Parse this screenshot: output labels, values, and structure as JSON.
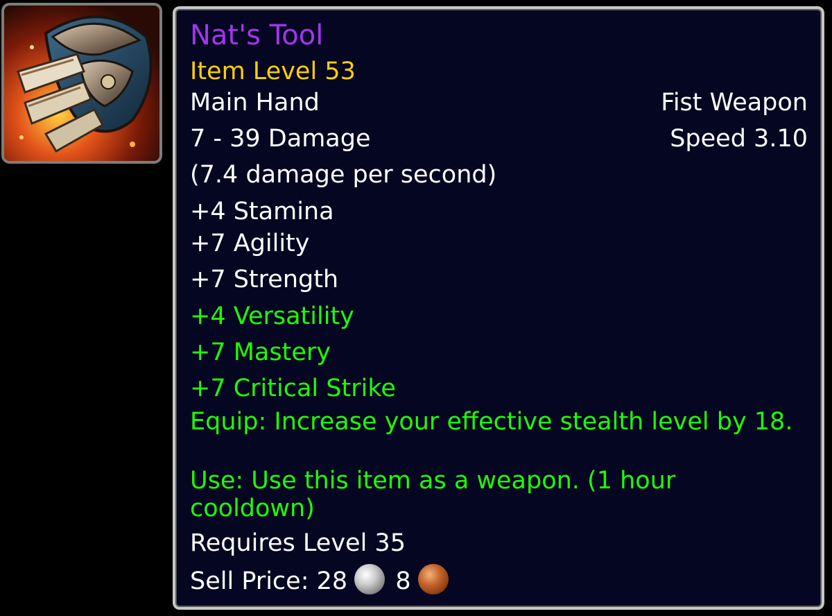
{
  "item": {
    "icon": "fist-weapon-item-icon",
    "name": "Nat's Tool",
    "item_level": "Item Level 53",
    "slot": "Main Hand",
    "type": "Fist Weapon",
    "damage": "7 - 39 Damage",
    "speed": "Speed 3.10",
    "dps": "(7.4 damage per second)",
    "stats": [
      "+4 Stamina",
      "+7 Agility",
      "+7 Strength"
    ],
    "secondary_stats": [
      "+4 Versatility",
      "+7 Mastery",
      "+7 Critical Strike"
    ],
    "equip_effect": "Equip: Increase your effective stealth level by 18.",
    "use_effect": "Use: Use this item as a weapon. (1 hour cooldown)",
    "requires": "Requires Level 35",
    "sell_price": {
      "label": "Sell Price:",
      "silver": "28",
      "copper": "8",
      "silver_icon": "silver-coin-icon",
      "copper_icon": "copper-coin-icon"
    }
  },
  "colors": {
    "epic_name": "#a335ee",
    "item_level": "#ffd100",
    "white_text": "#ffffff",
    "green_text": "#1eff00",
    "background": "#050621",
    "border": "#c7c7c7"
  }
}
